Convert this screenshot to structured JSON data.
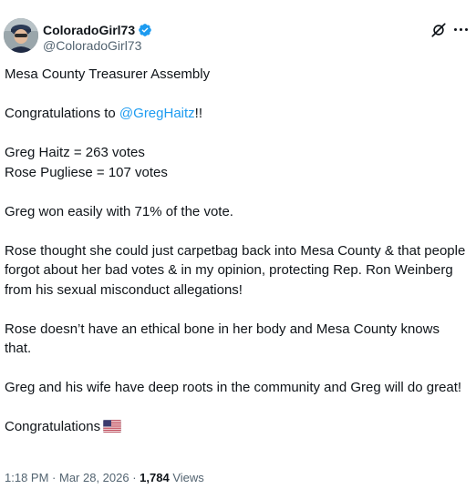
{
  "author": {
    "display_name": "ColoradoGirl73",
    "handle": "@ColoradoGirl73",
    "verified": true,
    "verified_color": "#1d9bf0"
  },
  "header_actions": {
    "grok_icon": "grok-icon",
    "more_icon": "more-horizontal-icon"
  },
  "post": {
    "line1": "Mesa County Treasurer Assembly",
    "line2_prefix": "Congratulations to ",
    "line2_mention": "@GregHaitz",
    "line2_suffix": "!!",
    "line3": "Greg Haitz = 263 votes",
    "line4": "Rose Pugliese = 107 votes",
    "line5": "Greg won easily with 71% of the vote.",
    "line6": "Rose thought she could just carpetbag back into Mesa County & that people forgot about her bad votes & in my opinion, protecting Rep. Ron Weinberg from his sexual misconduct allegations!",
    "line7": "Rose doesn’t have an ethical bone in her body and Mesa County knows that.",
    "line8": "Greg and his wife have deep roots in the community and Greg will do great!",
    "line9": "Congratulations",
    "line9_emoji": "us-flag-emoji"
  },
  "meta": {
    "time": "1:18 PM",
    "sep1": " · ",
    "date": "Mar 28, 2026",
    "sep2": " · ",
    "views_count": "1,784",
    "views_label": " Views"
  },
  "colors": {
    "text": "#0f1419",
    "secondary": "#536471",
    "link": "#1d9bf0"
  }
}
